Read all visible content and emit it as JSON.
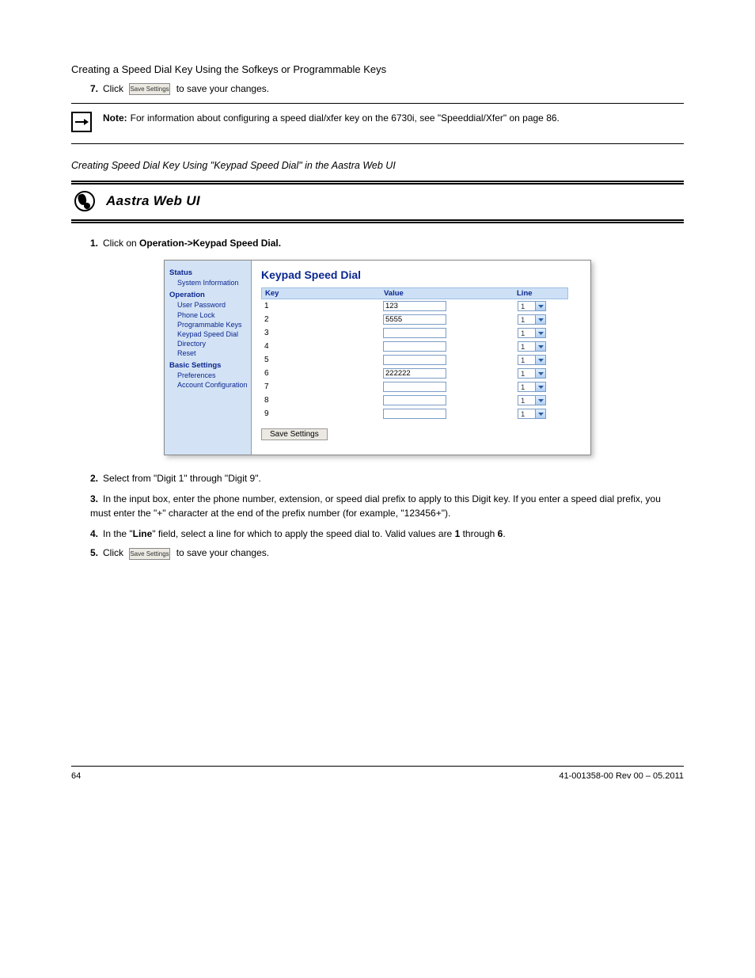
{
  "section_title_1": "Creating a Speed Dial Key Using the Sofkeys or Programmable\nKeys",
  "section_title_2": "Creating Speed Dial Key Using \"Keypad Speed Dial\" in the Aastra Web UI",
  "step7": {
    "num": "7.",
    "text": "Click ",
    "text_after": " to save your changes."
  },
  "save_btn_tiny_label": "Save Settings",
  "note": {
    "label": "Note:",
    "text": "For information about configuring a speed dial/xfer key on the 6730i, see \"Speeddial/Xfer\" on page 86."
  },
  "ui_header": "Aastra Web UI",
  "intro_step": {
    "num": "1.",
    "text": "Click on ",
    "bold1": "Operation->Keypad Speed Dial.",
    "after": "."
  },
  "sidebar": {
    "s1": "Status",
    "s1_1": "System Information",
    "s2": "Operation",
    "s2_1": "User Password",
    "s2_2": "Phone Lock",
    "s2_3": "Programmable Keys",
    "s2_4": "Keypad Speed Dial",
    "s2_5": "Directory",
    "s2_6": "Reset",
    "s3": "Basic Settings",
    "s3_1": "Preferences",
    "s3_2": "Account Configuration"
  },
  "panel": {
    "title": "Keypad Speed Dial",
    "col_key": "Key",
    "col_value": "Value",
    "col_line": "Line",
    "rows": [
      {
        "key": "1",
        "value": "123",
        "line": "1"
      },
      {
        "key": "2",
        "value": "5555",
        "line": "1"
      },
      {
        "key": "3",
        "value": "",
        "line": "1"
      },
      {
        "key": "4",
        "value": "",
        "line": "1"
      },
      {
        "key": "5",
        "value": "",
        "line": "1"
      },
      {
        "key": "6",
        "value": "222222",
        "line": "1"
      },
      {
        "key": "7",
        "value": "",
        "line": "1"
      },
      {
        "key": "8",
        "value": "",
        "line": "1"
      },
      {
        "key": "9",
        "value": "",
        "line": "1"
      }
    ],
    "save_label": "Save Settings"
  },
  "post_steps": {
    "s2": {
      "num": "2.",
      "text": "Select from \"Digit 1\" through \"Digit 9\"."
    },
    "s3": {
      "num": "3.",
      "text": "In the input box, enter the phone number, extension, or speed dial prefix to apply to this Digit key. If you enter a speed dial prefix, you must enter the \"+\" character at the end of the prefix number (for example, \"123456+\")."
    },
    "s4": {
      "num": "4.",
      "text": "In the \"",
      "bold": "Line",
      "text2": "\" field, select a line for which to apply the speed dial to. Valid values are ",
      "bold2": "1",
      "text3": " through ",
      "bold3": "6",
      "text4": "."
    },
    "s5": {
      "num": "5.",
      "text": "Click ",
      "text_after": " to save your changes."
    }
  },
  "footer": {
    "page": "64",
    "ref": "41-001358-00 Rev 00 – 05.2011"
  }
}
